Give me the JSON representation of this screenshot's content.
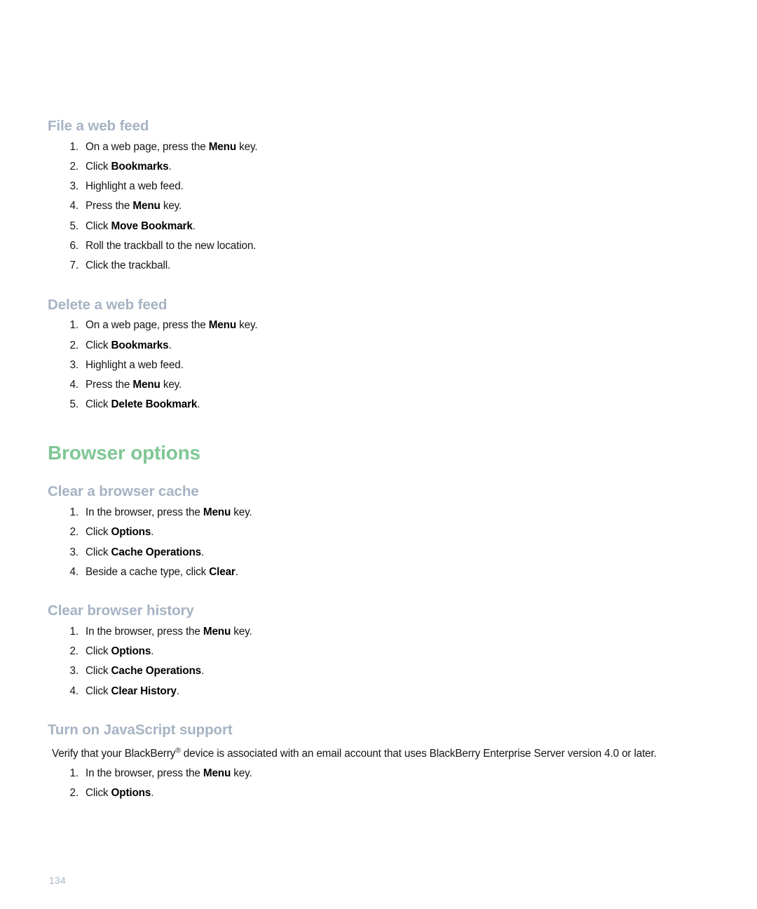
{
  "document": {
    "page_number": "134",
    "colors": {
      "chapter_heading": "#7fc795",
      "section_heading": "#a6b3c3",
      "body_text": "#151515",
      "folio": "#a9b6c4",
      "background": "#ffffff"
    }
  },
  "sections": [
    {
      "id": "file-a-web-feed",
      "level": "h2",
      "heading": "File a web feed",
      "steps": [
        {
          "number": "1.",
          "pre": "On a web page, press the ",
          "bold": "Menu",
          "post": " key."
        },
        {
          "number": "2.",
          "pre": "Click ",
          "bold": "Bookmarks",
          "post": "."
        },
        {
          "number": "3.",
          "pre": "Highlight a web feed.",
          "bold": "",
          "post": ""
        },
        {
          "number": "4.",
          "pre": "Press the ",
          "bold": "Menu",
          "post": " key."
        },
        {
          "number": "5.",
          "pre": "Click ",
          "bold": "Move Bookmark",
          "post": "."
        },
        {
          "number": "6.",
          "pre": "Roll the trackball to the new location.",
          "bold": "",
          "post": ""
        },
        {
          "number": "7.",
          "pre": "Click the trackball.",
          "bold": "",
          "post": ""
        }
      ]
    },
    {
      "id": "delete-a-web-feed",
      "level": "h2",
      "heading": "Delete a web feed",
      "steps": [
        {
          "number": "1.",
          "pre": "On a web page, press the ",
          "bold": "Menu",
          "post": " key."
        },
        {
          "number": "2.",
          "pre": "Click ",
          "bold": "Bookmarks",
          "post": "."
        },
        {
          "number": "3.",
          "pre": "Highlight a web feed.",
          "bold": "",
          "post": ""
        },
        {
          "number": "4.",
          "pre": "Press the ",
          "bold": "Menu",
          "post": " key."
        },
        {
          "number": "5.",
          "pre": "Click ",
          "bold": "Delete Bookmark",
          "post": "."
        }
      ]
    }
  ],
  "chapter": {
    "id": "browser-options",
    "heading": "Browser options",
    "sections": [
      {
        "id": "clear-a-browser-cache",
        "level": "h2",
        "heading": "Clear a browser cache",
        "steps": [
          {
            "number": "1.",
            "pre": "In the browser, press the ",
            "bold": "Menu",
            "post": " key."
          },
          {
            "number": "2.",
            "pre": "Click ",
            "bold": "Options",
            "post": "."
          },
          {
            "number": "3.",
            "pre": "Click ",
            "bold": "Cache Operations",
            "post": "."
          },
          {
            "number": "4.",
            "pre": "Beside a cache type, click ",
            "bold": "Clear",
            "post": "."
          }
        ]
      },
      {
        "id": "clear-browser-history",
        "level": "h2",
        "heading": "Clear browser history",
        "steps": [
          {
            "number": "1.",
            "pre": "In the browser, press the ",
            "bold": "Menu",
            "post": " key."
          },
          {
            "number": "2.",
            "pre": "Click ",
            "bold": "Options",
            "post": "."
          },
          {
            "number": "3.",
            "pre": "Click ",
            "bold": "Cache Operations",
            "post": "."
          },
          {
            "number": "4.",
            "pre": "Click ",
            "bold": "Clear History",
            "post": "."
          }
        ]
      },
      {
        "id": "turn-on-javascript-support",
        "level": "h2",
        "heading": "Turn on JavaScript support",
        "intro": {
          "part1": "Verify that your BlackBerry",
          "superscript": "®",
          "part2": " device is associated with an email account that uses BlackBerry Enterprise Server version 4.0 or later."
        },
        "steps": [
          {
            "number": "1.",
            "pre": "In the browser, press the ",
            "bold": "Menu",
            "post": " key."
          },
          {
            "number": "2.",
            "pre": "Click ",
            "bold": "Options",
            "post": "."
          }
        ]
      }
    ]
  }
}
